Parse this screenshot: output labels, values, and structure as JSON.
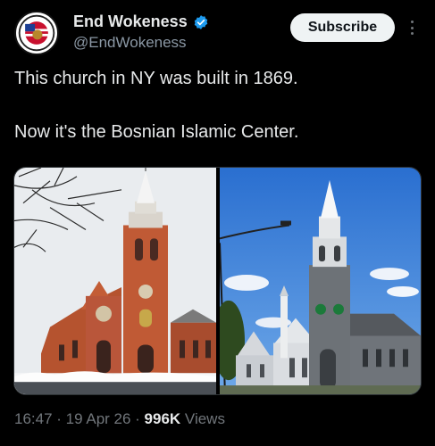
{
  "header": {
    "display_name": "End Wokeness",
    "handle": "@EndWokeness",
    "subscribe_label": "Subscribe"
  },
  "tweet": {
    "line1": "This church in NY was built in 1869.",
    "line2": "Now it's the Bosnian Islamic Center."
  },
  "meta": {
    "time": "16:47",
    "sep1": " · ",
    "date": "19 Apr 26",
    "sep2": " · ",
    "views_count": "996K",
    "views_label": " Views"
  },
  "colors": {
    "background": "#000000",
    "verified": "#1d9bf0",
    "subscribe_bg": "#eff3f4",
    "muted_text": "#71767b"
  }
}
